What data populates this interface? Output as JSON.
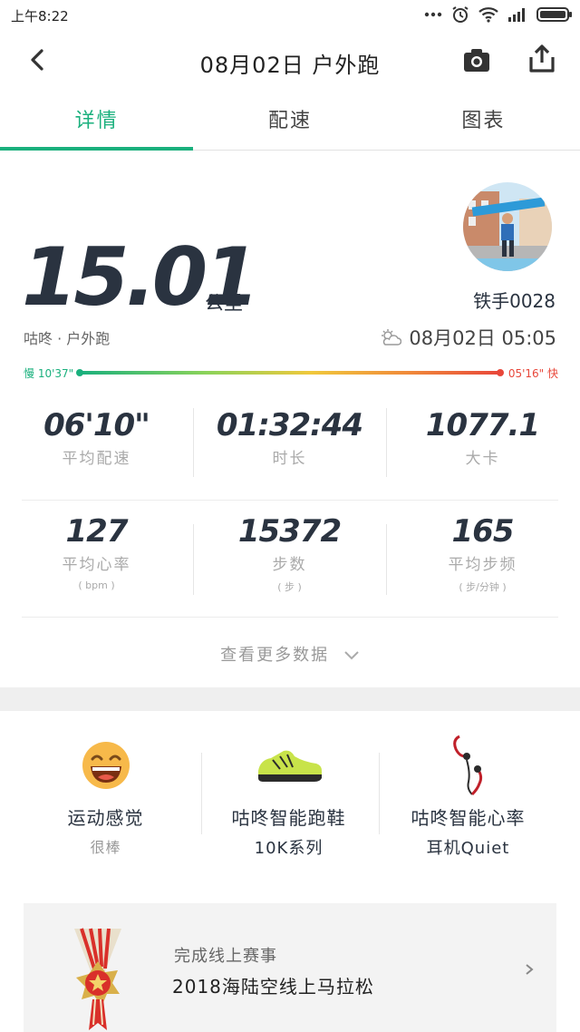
{
  "status": {
    "time": "上午8:22"
  },
  "header": {
    "title": "08月02日 户外跑"
  },
  "tabs": [
    "详情",
    "配速",
    "图表"
  ],
  "summary": {
    "distance": "15.01",
    "unit": "公里",
    "source": "咕咚 · 户外跑",
    "username": "铁手0028",
    "datetime": "08月02日  05:05",
    "pace_slow": "慢 10'37\"",
    "pace_fast": "05'16\" 快"
  },
  "stats": [
    {
      "value": "06'10\"",
      "label": "平均配速",
      "sub": ""
    },
    {
      "value": "01:32:44",
      "label": "时长",
      "sub": ""
    },
    {
      "value": "1077.1",
      "label": "大卡",
      "sub": ""
    },
    {
      "value": "127",
      "label": "平均心率",
      "sub": "( bpm )"
    },
    {
      "value": "15372",
      "label": "步数",
      "sub": "( 步 )"
    },
    {
      "value": "165",
      "label": "平均步频",
      "sub": "( 步/分钟 )"
    }
  ],
  "more_label": "查看更多数据",
  "gear": [
    {
      "title": "运动感觉",
      "subtitle": "很棒"
    },
    {
      "title": "咕咚智能跑鞋",
      "subtitle": "10K系列"
    },
    {
      "title": "咕咚智能心率",
      "subtitle": "耳机Quiet"
    }
  ],
  "event": {
    "label": "完成线上赛事",
    "name": "2018海陆空线上马拉松"
  },
  "colors": {
    "accent": "#1ab07d",
    "slow": "#1ab07d",
    "fast": "#e8473a",
    "text_dark": "#2a3340"
  }
}
